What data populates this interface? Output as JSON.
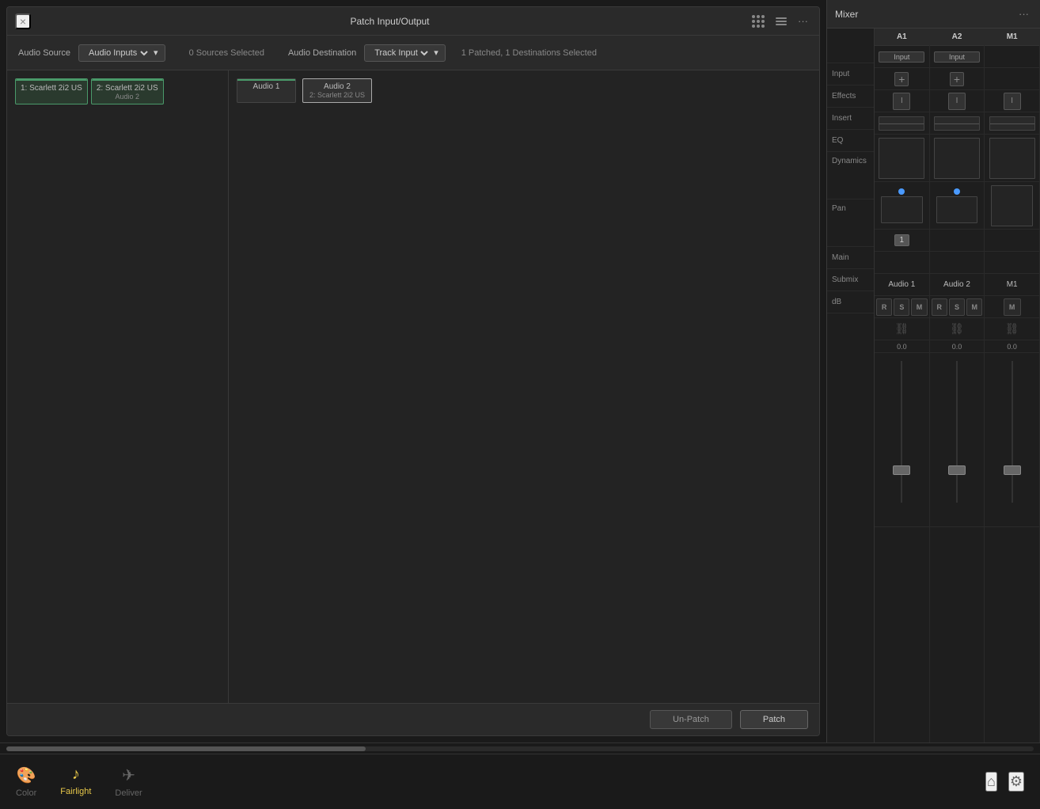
{
  "window": {
    "title": "Patch Input/Output"
  },
  "mixer": {
    "title": "Mixer",
    "channels": [
      "A1",
      "A2",
      "M1"
    ],
    "channel_names": [
      "Audio 1",
      "Audio 2",
      "M1"
    ],
    "input_label": "Input",
    "effects_label": "Effects",
    "insert_label": "Insert",
    "eq_label": "EQ",
    "dynamics_label": "Dynamics",
    "pan_label": "Pan",
    "main_label": "Main",
    "submix_label": "Submix",
    "main_badge": "1",
    "dB_label": "dB",
    "fader_values": [
      "0.0",
      "0.0",
      "0.0"
    ],
    "input_values": [
      "Input",
      "Input",
      ""
    ],
    "r_btn": "R",
    "s_btn": "S",
    "m_btn": "M",
    "pan_colors": [
      "#4a9aff",
      "#4a9aff"
    ]
  },
  "patch": {
    "close_label": "×",
    "title": "Patch Input/Output",
    "audio_source_label": "Audio Source",
    "audio_source_dropdown": "Audio Inputs",
    "sources_count": "0 Sources Selected",
    "audio_destination_label": "Audio Destination",
    "audio_destination_dropdown": "Track Input",
    "destinations_count": "1 Patched, 1 Destinations Selected",
    "source_tracks": [
      {
        "name": "1: Scarlett 2i2 US",
        "line": true
      },
      {
        "name": "2: Scarlett 2i2 US",
        "sub": "Audio 2",
        "line": true
      }
    ],
    "dest_tracks": [
      {
        "name": "Audio 1",
        "line": true,
        "selected": false
      },
      {
        "name": "Audio 2",
        "sub": "2: Scarlett 2i2 US",
        "line": false,
        "selected": true
      }
    ],
    "unpatch_btn": "Un-Patch",
    "patch_btn": "Patch"
  },
  "bottom_nav": {
    "tabs": [
      {
        "id": "color",
        "label": "Color",
        "icon": "🎨"
      },
      {
        "id": "fairlight",
        "label": "Fairlight",
        "icon": "♪",
        "active": true
      },
      {
        "id": "deliver",
        "label": "Deliver",
        "icon": "✈"
      }
    ],
    "home_icon": "⌂",
    "settings_icon": "⚙"
  }
}
